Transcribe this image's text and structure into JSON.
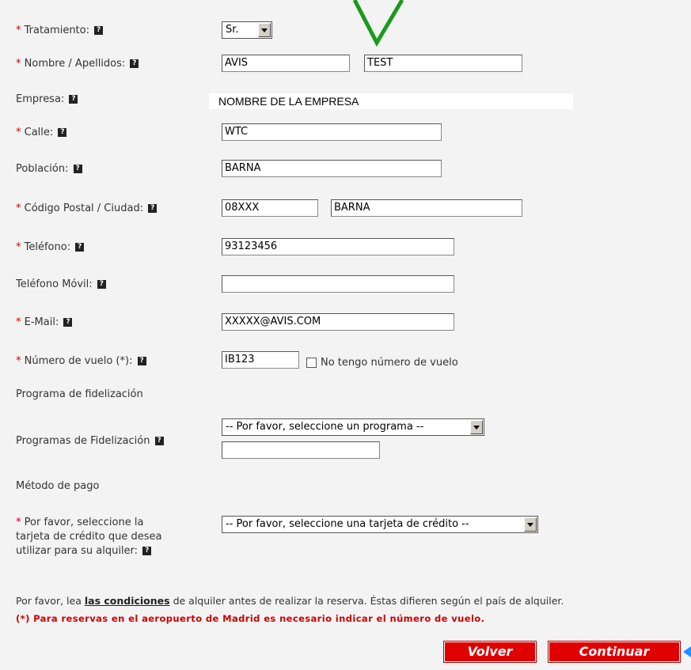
{
  "form": {
    "tratamiento": {
      "label": "Tratamiento:",
      "value": "Sr."
    },
    "nombre": {
      "label": "Nombre / Apellidos:",
      "first": "AVIS",
      "last": "TEST"
    },
    "empresa": {
      "label": "Empresa:",
      "value": "NOMBRE DE LA EMPRESA"
    },
    "calle": {
      "label": "Calle:",
      "value": "WTC"
    },
    "poblacion": {
      "label": "Población:",
      "value": "BARNA"
    },
    "codigo": {
      "label": "Código Postal / Ciudad:",
      "postal": "08XXX",
      "city": "BARNA"
    },
    "telefono": {
      "label": "Teléfono:",
      "value": "93123456"
    },
    "movil": {
      "label": "Teléfono Móvil:",
      "value": ""
    },
    "email": {
      "label": "E-Mail:",
      "value": "XXXXX@AVIS.COM"
    },
    "vuelo": {
      "label": "Número de vuelo (*):",
      "value": "IB123",
      "no_flight_label": "No tengo número de vuelo"
    },
    "fidelizacion_heading": "Programa de fidelización",
    "programas": {
      "label": "Programas de Fidelización",
      "selected": "-- Por favor, seleccione un programa --",
      "number": ""
    },
    "pago_heading": "Método de pago",
    "tarjeta": {
      "label_line1": "Por favor, seleccione la",
      "label_line2": "tarjeta de crédito que desea",
      "label_line3": "utilizar para su alquiler:",
      "selected": "-- Por favor, seleccione una tarjeta de crédito --"
    },
    "required_mark": "*",
    "help_glyph": "?"
  },
  "conditions": {
    "before": "Por favor, lea ",
    "link": "las condiciones",
    "after": " de alquiler antes de realizar la reserva. Éstas difieren según el país de alquiler.",
    "madrid_note": "(*) Para reservas en el aeropuerto de Madrid es necesario indicar el número de vuelo."
  },
  "buttons": {
    "back": "Volver",
    "continue": "Continuar"
  },
  "colors": {
    "required": "#cc0000",
    "button_bg": "#e00000",
    "annotation_check": "#1a9a1a",
    "annotation_arrow": "#1e90ff"
  }
}
